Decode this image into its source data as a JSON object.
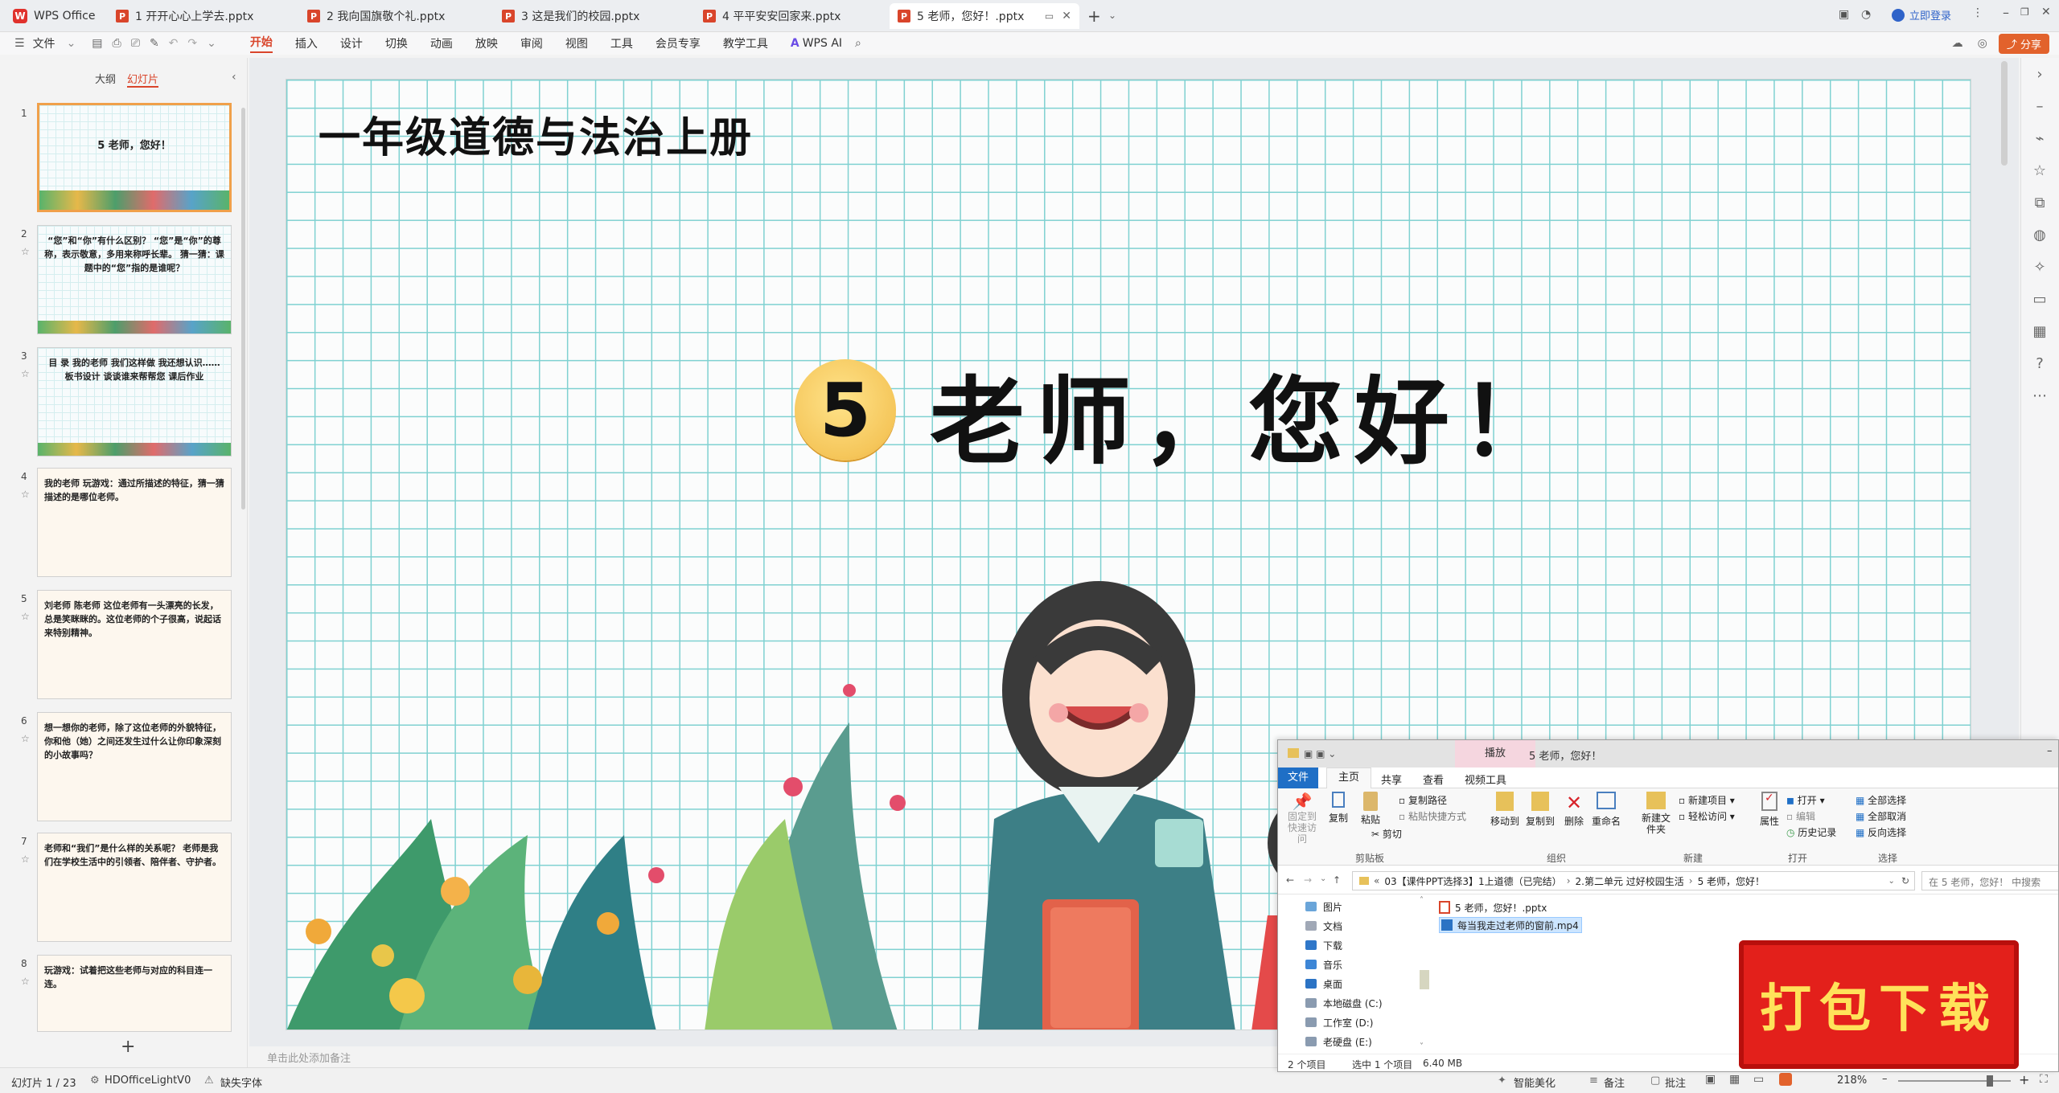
{
  "app": {
    "name": "WPS Office"
  },
  "tabs": [
    {
      "label": "1 开开心心上学去.pptx"
    },
    {
      "label": "2 我向国旗敬个礼.pptx"
    },
    {
      "label": "3 这是我们的校园.pptx"
    },
    {
      "label": "4 平平安安回家来.pptx"
    },
    {
      "label": "5 老师，您好！.pptx"
    }
  ],
  "titlebar_right": {
    "login": "立即登录"
  },
  "menubar": {
    "file": "文件",
    "items": [
      "开始",
      "插入",
      "设计",
      "切换",
      "动画",
      "放映",
      "审阅",
      "视图",
      "工具",
      "会员专享",
      "教学工具"
    ],
    "wps_ai": "WPS AI",
    "share": "分享"
  },
  "leftpanel": {
    "tab_outline": "大纲",
    "tab_slides": "幻灯片",
    "thumbs": [
      {
        "num": "1",
        "text": "5 老师，您好！"
      },
      {
        "num": "2",
        "text": "“您”和“你”有什么区别？ “您”是“你”的尊称，表示敬意，多用来称呼长辈。 猜一猜：课题中的“您”指的是谁呢？"
      },
      {
        "num": "3",
        "text": "目 录 我的老师 我们这样做 我还想认识…… 板书设计 谈谈谁来帮帮您 课后作业"
      },
      {
        "num": "4",
        "text": "我的老师 玩游戏：通过所描述的特征，猜一猜描述的是哪位老师。"
      },
      {
        "num": "5",
        "text": "刘老师 陈老师 这位老师有一头漂亮的长发，总是笑眯眯的。这位老师的个子很高，说起话来特别精神。"
      },
      {
        "num": "6",
        "text": "想一想你的老师，除了这位老师的外貌特征，你和他（她）之间还发生过什么让你印象深刻的小故事吗？"
      },
      {
        "num": "7",
        "text": "老师和“我们”是什么样的关系呢？ 老师是我们在学校生活中的引领者、陪伴者、守护者。"
      },
      {
        "num": "8",
        "text": "玩游戏：试着把这些老师与对应的科目连一连。"
      }
    ],
    "add": "+"
  },
  "slide": {
    "subject": "一年级道德与法治上册",
    "lesson_number": "5",
    "lesson_title": "老师，您好！"
  },
  "notes_placeholder": "单击此处添加备注",
  "statusbar": {
    "slide_info": "幻灯片 1 / 23",
    "theme": "HDOfficeLightV0",
    "missing_font": "缺失字体",
    "beautify": "智能美化",
    "notes": "备注",
    "comments": "批注",
    "zoom": "218%"
  },
  "explorer": {
    "title_tab": "播放",
    "title_path": "5 老师，您好！",
    "ribbon_tabs": [
      "文件",
      "主页",
      "共享",
      "查看",
      "视频工具"
    ],
    "clipboard": {
      "pin": "固定到快速访问",
      "copy": "复制",
      "paste": "粘贴",
      "copy_path": "复制路径",
      "paste_shortcut": "粘贴快捷方式",
      "cut": "剪切",
      "group": "剪贴板"
    },
    "organize": {
      "move": "移动到",
      "copyto": "复制到",
      "delete": "删除",
      "rename": "重命名",
      "group": "组织"
    },
    "new": {
      "folder": "新建文件夹",
      "item": "新建项目",
      "easy": "轻松访问",
      "group": "新建"
    },
    "open": {
      "props": "属性",
      "open": "打开",
      "edit": "编辑",
      "history": "历史记录",
      "group": "打开"
    },
    "select": {
      "all": "全部选择",
      "none": "全部取消",
      "invert": "反向选择",
      "group": "选择"
    },
    "address": [
      "03【课件PPT选择3】1上道德（已完结）",
      "2.第二单元 过好校园生活",
      "5 老师，您好！"
    ],
    "search_placeholder": "在 5 老师，您好！ 中搜索",
    "nav": [
      "图片",
      "文档",
      "下载",
      "音乐",
      "桌面",
      "本地磁盘 (C:)",
      "工作室 (D:)",
      "老硬盘 (E:)"
    ],
    "files": [
      {
        "name": "5 老师，您好！.pptx",
        "type": "pptx"
      },
      {
        "name": "每当我走过老师的窗前.mp4",
        "type": "mp4"
      }
    ],
    "status_count": "2 个项目",
    "status_selected": "选中 1 个项目",
    "status_size": "6.40 MB"
  },
  "download_stamp": "打包下载",
  "colors": {
    "accent": "#d9452b",
    "grid": "#7fd1d1",
    "badge": "#f5c65a",
    "stamp": "#e3201b"
  }
}
